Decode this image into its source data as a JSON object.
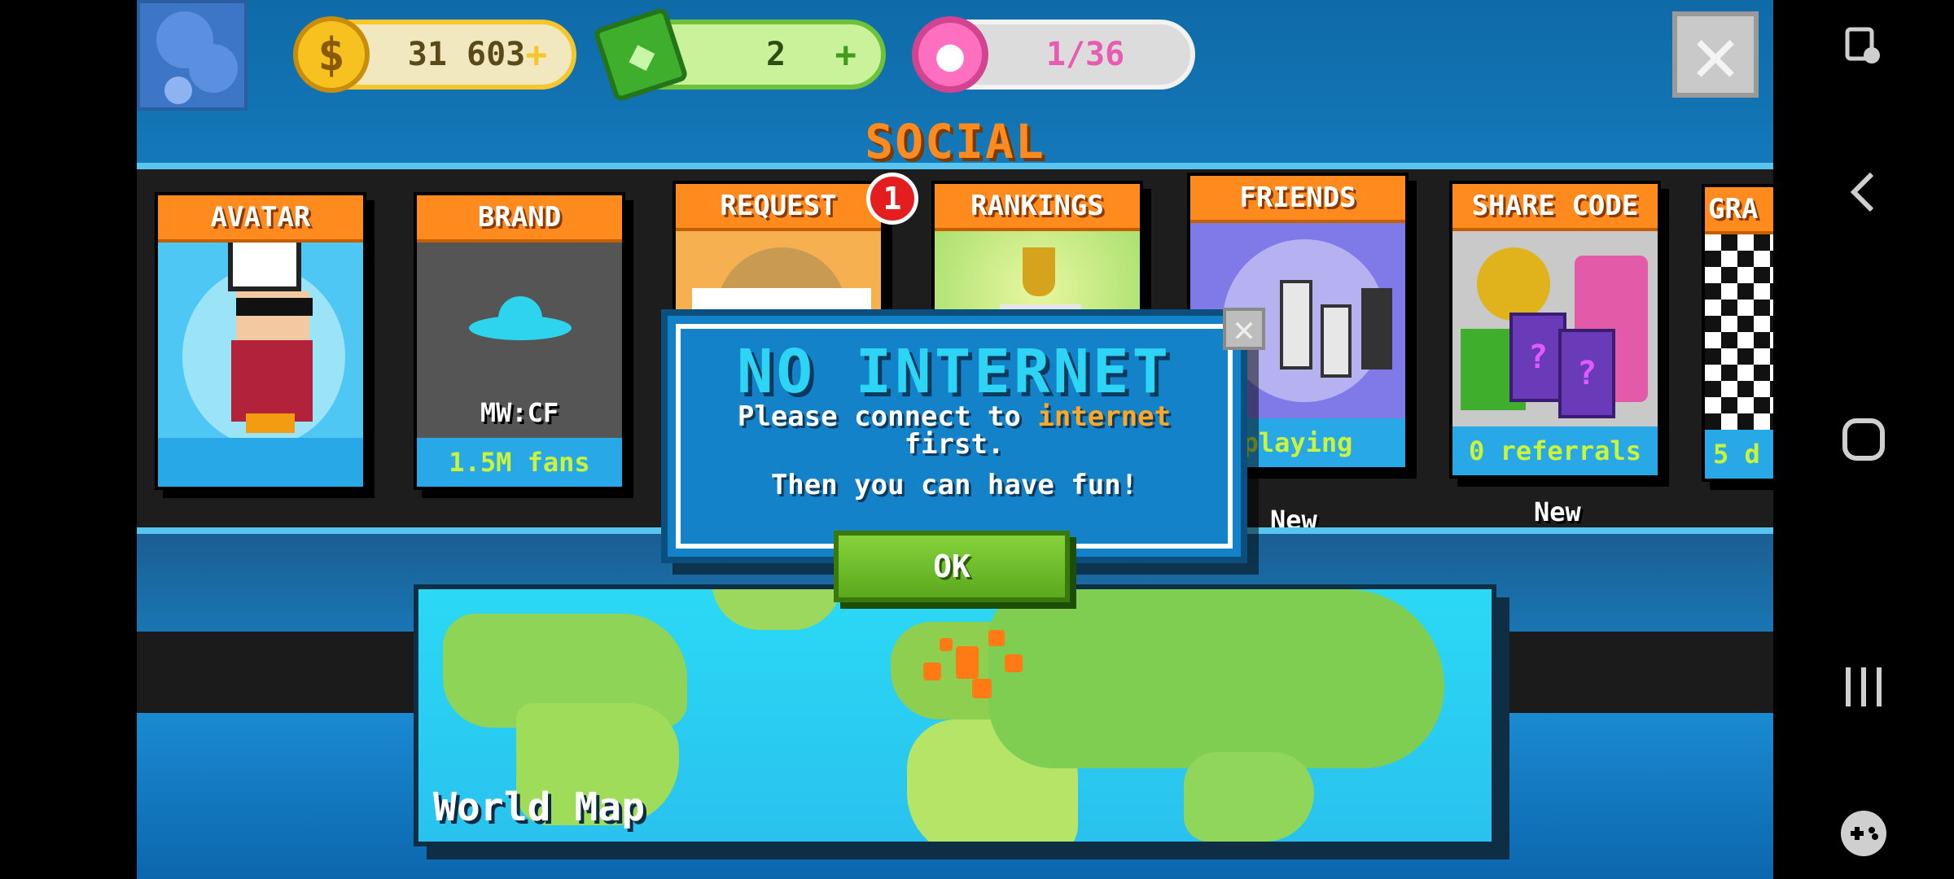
{
  "currencies": {
    "coins": {
      "value": "31 603",
      "plus": "+"
    },
    "cash": {
      "value": "2",
      "plus": "+"
    },
    "donuts": {
      "value": "1/36"
    }
  },
  "header": {
    "title": "SOCIAL",
    "close_icon": "close-icon"
  },
  "cards": [
    {
      "id": "avatar",
      "title": "AVATAR",
      "footer": ""
    },
    {
      "id": "brand",
      "title": "BRAND",
      "caption": "MW:CF",
      "footer": "1.5M fans"
    },
    {
      "id": "request",
      "title": "REQUEST",
      "badge": "1",
      "footer": ""
    },
    {
      "id": "rankings",
      "title": "RANKINGS",
      "footer": ""
    },
    {
      "id": "friends",
      "title": "FRIENDS",
      "footer": "playing",
      "label": "New"
    },
    {
      "id": "share-code",
      "title": "SHARE CODE",
      "footer": "0 referrals",
      "label": "New"
    },
    {
      "id": "grand",
      "title": "GRA",
      "footer": "5 d"
    }
  ],
  "dialog": {
    "title": "NO INTERNET",
    "line1_pre": "Please connect to ",
    "line1_highlight": "internet",
    "line2": "first.",
    "line3": "Then you can have fun!",
    "ok_label": "OK"
  },
  "map": {
    "title": "World Map"
  },
  "colors": {
    "accent_orange": "#ff8a1e",
    "title_cyan": "#2dd4f4",
    "ok_green": "#6ec23a",
    "fans_yellow": "#c9f43a"
  },
  "android_nav": {
    "icons": [
      "screen-touch-icon",
      "back-icon",
      "home-icon",
      "recents-icon",
      "game-tools-icon"
    ]
  }
}
